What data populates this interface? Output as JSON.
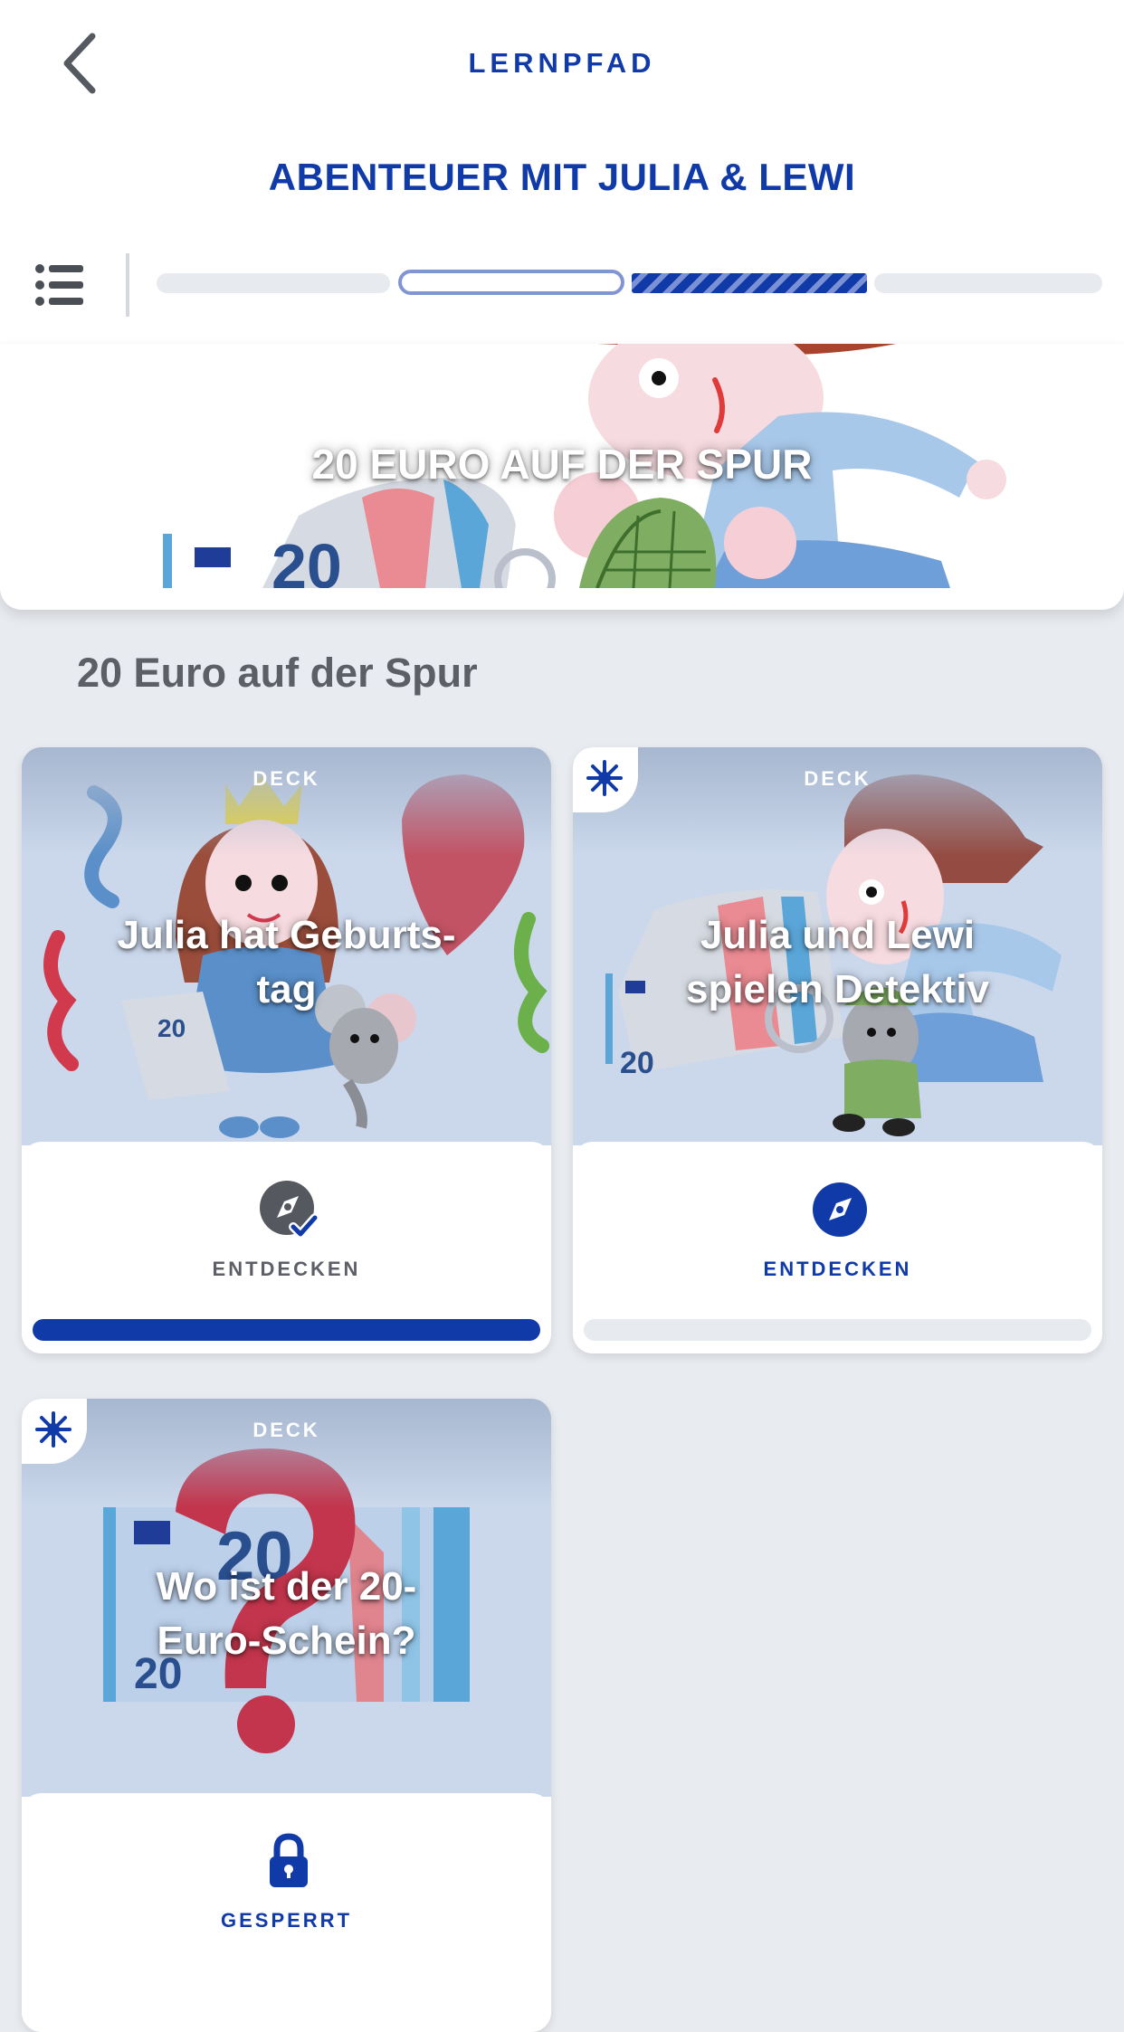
{
  "header": {
    "title": "LERNPFAD",
    "course_title": "ABENTEUER MIT JULIA & LEWI"
  },
  "banner": {
    "title": "20 EURO AUF DER SPUR"
  },
  "section": {
    "title": "20 Euro auf der Spur"
  },
  "cards": [
    {
      "type_label": "DECK",
      "title_line1": "Julia hat Geburts-",
      "title_line2": "tag",
      "action_label": "ENTDECKEN",
      "status": "completed",
      "progress": 1.0,
      "new": false
    },
    {
      "type_label": "DECK",
      "title_line1": "Julia und Lewi",
      "title_line2": "spielen Detektiv",
      "action_label": "ENTDECKEN",
      "status": "available",
      "progress": 0.0,
      "new": true
    },
    {
      "type_label": "DECK",
      "title_line1": "Wo ist der 20-",
      "title_line2": "Euro-Schein?",
      "action_label": "GESPERRT",
      "status": "locked",
      "progress": 0.0,
      "new": true
    }
  ],
  "colors": {
    "brand": "#0f3aa8",
    "completed_gray": "#5c5f66",
    "background": "#e8ebf0"
  },
  "icons": [
    "back-icon",
    "list-icon",
    "compass-check-icon",
    "compass-icon",
    "lock-icon",
    "new-star-icon"
  ]
}
